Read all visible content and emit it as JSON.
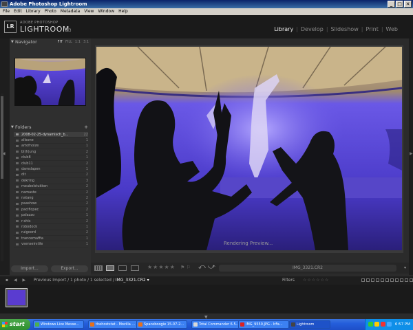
{
  "window": {
    "title": "Adobe Photoshop Lightroom",
    "controls": [
      "_",
      "□",
      "✕"
    ]
  },
  "menu": [
    "File",
    "Edit",
    "Library",
    "Photo",
    "Metadata",
    "View",
    "Window",
    "Help"
  ],
  "brand": {
    "logo": "LR",
    "sub": "ADOBE PHOTOSHOP",
    "name": "LIGHTROOM",
    "version": "1.3"
  },
  "modules": [
    {
      "label": "Library",
      "active": true
    },
    {
      "label": "Develop",
      "active": false
    },
    {
      "label": "Slideshow",
      "active": false
    },
    {
      "label": "Print",
      "active": false
    },
    {
      "label": "Web",
      "active": false
    }
  ],
  "navigator": {
    "title": "Navigator",
    "zoom_options": [
      "FIT",
      "FILL",
      "1:1",
      "3:1"
    ],
    "selected_zoom": "FIT"
  },
  "folders": {
    "title": "Folders",
    "add_symbol": "+",
    "items": [
      {
        "name": "2008-02-25-dynamisch_b...",
        "count": "22",
        "selected": true
      },
      {
        "name": "allsone",
        "count": "1"
      },
      {
        "name": "artofnoize",
        "count": "1"
      },
      {
        "name": "bl(h)ung",
        "count": "2"
      },
      {
        "name": "club8",
        "count": "1"
      },
      {
        "name": "club11",
        "count": "2"
      },
      {
        "name": "damslapen",
        "count": "1"
      },
      {
        "name": "dlt",
        "count": "2"
      },
      {
        "name": "dekring",
        "count": "3"
      },
      {
        "name": "meubelstukken",
        "count": "2"
      },
      {
        "name": "namaste",
        "count": "2"
      },
      {
        "name": "natang",
        "count": "2"
      },
      {
        "name": "paashow",
        "count": "2"
      },
      {
        "name": "pacificpec",
        "count": "2"
      },
      {
        "name": "palazzo",
        "count": "1"
      },
      {
        "name": "r:shis",
        "count": "2"
      },
      {
        "name": "robodock",
        "count": "1"
      },
      {
        "name": "ruigoord",
        "count": "2"
      },
      {
        "name": "trancemaffia",
        "count": "1"
      },
      {
        "name": "vsenseirstile",
        "count": "1"
      }
    ]
  },
  "buttons": {
    "import": "Import...",
    "export": "Export..."
  },
  "main": {
    "status": "Rendering Preview..."
  },
  "toolbar": {
    "stars": "★★★★★",
    "flags": "⚑ ⚐",
    "filename": "IMG_3321.CR2",
    "rotate_left": "⤺",
    "rotate_right": "⤻",
    "dropdown": "▾"
  },
  "filmbar": {
    "icons": "▪ ◀ ▶",
    "path_prefix": "Previous Import / 1 photo / 1 selected /",
    "current": "IMG_3321.CR2 ▾",
    "filters": "Filters",
    "stars": "☆☆☆☆☆☆"
  },
  "taskbar": {
    "start": "start",
    "tasks": [
      {
        "label": "Windows Live Messe...",
        "color": "#4caf50"
      },
      {
        "label": "thehoststat - Mozilla ...",
        "color": "#e8701a"
      },
      {
        "label": "Spaceboogie 15-07-2...",
        "color": "#e8701a"
      },
      {
        "label": "Total Commander 6.5...",
        "color": "#d9d9d9"
      },
      {
        "label": "IMG_9550.JPG - IrFa...",
        "color": "#d22"
      },
      {
        "label": "Lightroom",
        "color": "#444",
        "active": true
      }
    ],
    "clock": "6:57 PM"
  }
}
